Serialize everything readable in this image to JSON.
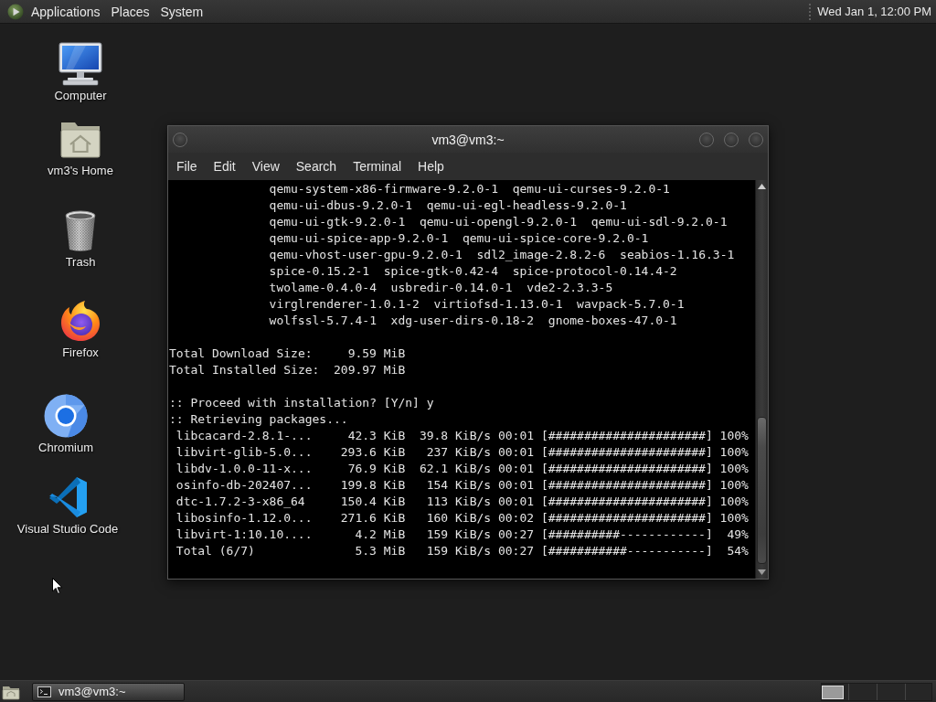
{
  "top_panel": {
    "menus": [
      "Applications",
      "Places",
      "System"
    ],
    "clock": "Wed Jan 1, 12:00 PM"
  },
  "desktop": {
    "icons": [
      {
        "kind": "computer",
        "label": "Computer"
      },
      {
        "kind": "home",
        "label": "vm3's Home"
      },
      {
        "kind": "trash",
        "label": "Trash"
      },
      {
        "kind": "firefox",
        "label": "Firefox"
      },
      {
        "kind": "chromium",
        "label": "Chromium"
      },
      {
        "kind": "vscode",
        "label": "Visual Studio Code"
      }
    ]
  },
  "terminal_window": {
    "title": "vm3@vm3:~",
    "menu": [
      "File",
      "Edit",
      "View",
      "Search",
      "Terminal",
      "Help"
    ],
    "package_lines": [
      "qemu-system-x86-firmware-9.2.0-1  qemu-ui-curses-9.2.0-1",
      "qemu-ui-dbus-9.2.0-1  qemu-ui-egl-headless-9.2.0-1",
      "qemu-ui-gtk-9.2.0-1  qemu-ui-opengl-9.2.0-1  qemu-ui-sdl-9.2.0-1",
      "qemu-ui-spice-app-9.2.0-1  qemu-ui-spice-core-9.2.0-1",
      "qemu-vhost-user-gpu-9.2.0-1  sdl2_image-2.8.2-6  seabios-1.16.3-1",
      "spice-0.15.2-1  spice-gtk-0.42-4  spice-protocol-0.14.4-2",
      "twolame-0.4.0-4  usbredir-0.14.0-1  vde2-2.3.3-5",
      "virglrenderer-1.0.1-2  virtiofsd-1.13.0-1  wavpack-5.7.0-1",
      "wolfssl-5.7.4-1  xdg-user-dirs-0.18-2  gnome-boxes-47.0-1"
    ],
    "size_summary": [
      {
        "label": "Total Download Size:",
        "value": "9.59 MiB"
      },
      {
        "label": "Total Installed Size:",
        "value": "209.97 MiB"
      }
    ],
    "prompt_lines": [
      ":: Proceed with installation? [Y/n] y",
      ":: Retrieving packages..."
    ],
    "download_rows": [
      {
        "name": "libcacard-2.8.1-...",
        "size": "42.3 KiB",
        "rate": "39.8 KiB/s",
        "time": "00:01",
        "bar": "[######################]",
        "percent": "100%"
      },
      {
        "name": "libvirt-glib-5.0...",
        "size": "293.6 KiB",
        "rate": "237 KiB/s",
        "time": "00:01",
        "bar": "[######################]",
        "percent": "100%"
      },
      {
        "name": "libdv-1.0.0-11-x...",
        "size": "76.9 KiB",
        "rate": "62.1 KiB/s",
        "time": "00:01",
        "bar": "[######################]",
        "percent": "100%"
      },
      {
        "name": "osinfo-db-202407...",
        "size": "199.8 KiB",
        "rate": "154 KiB/s",
        "time": "00:01",
        "bar": "[######################]",
        "percent": "100%"
      },
      {
        "name": "dtc-1.7.2-3-x86_64",
        "size": "150.4 KiB",
        "rate": "113 KiB/s",
        "time": "00:01",
        "bar": "[######################]",
        "percent": "100%"
      },
      {
        "name": "libosinfo-1.12.0...",
        "size": "271.6 KiB",
        "rate": "160 KiB/s",
        "time": "00:02",
        "bar": "[######################]",
        "percent": "100%"
      },
      {
        "name": "libvirt-1:10.10....",
        "size": "4.2 MiB",
        "rate": "159 KiB/s",
        "time": "00:27",
        "bar": "[##########------------]",
        "percent": "49%"
      },
      {
        "name": "Total (6/7)",
        "size": "5.3 MiB",
        "rate": "159 KiB/s",
        "time": "00:27",
        "bar": "[###########-----------]",
        "percent": "54%"
      }
    ]
  },
  "bottom_panel": {
    "tasks": [
      {
        "label": "vm3@vm3:~",
        "selected": true
      }
    ]
  }
}
